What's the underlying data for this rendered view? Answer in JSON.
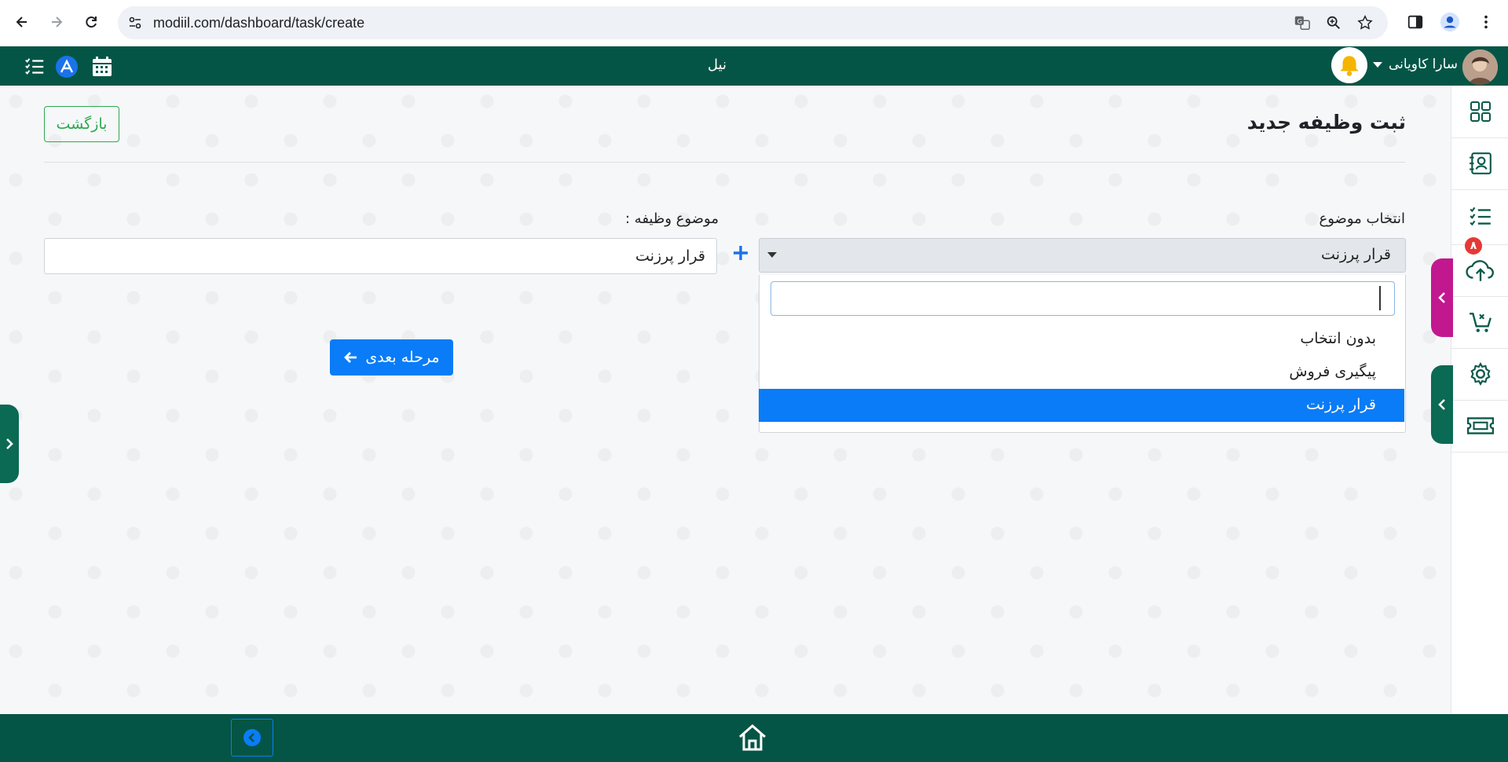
{
  "browser": {
    "url": "modiil.com/dashboard/task/create"
  },
  "appbar": {
    "center_title": "نیل",
    "user_name": "سارا کاویانی"
  },
  "page": {
    "title": "ثبت وظیفه جدید",
    "back_label": "بازگشت"
  },
  "form": {
    "topic_label": "انتخاب موضوع",
    "topic_selected": "قرار پرزنت",
    "task_subject_label": "موضوع وظیفه :",
    "task_subject_value": "قرار پرزنت",
    "next_label": "مرحله بعدی",
    "dropdown_options": [
      "بدون انتخاب",
      "پیگیری فروش",
      "قرار پرزنت"
    ]
  },
  "sidebar": {
    "tasks_badge": "۸"
  },
  "colors": {
    "brand_green": "#055546",
    "primary_blue": "#0a7cf7",
    "outline_green": "#2fa84f",
    "magenta_tab": "#c2188f",
    "badge_red": "#e53935"
  }
}
